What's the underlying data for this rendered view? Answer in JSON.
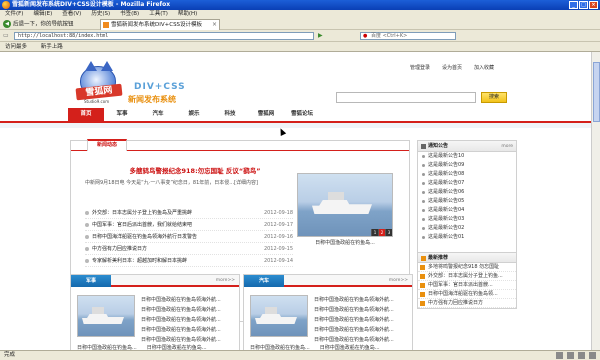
{
  "browser": {
    "title": "雪狐新闻发布系统DIV+CSS设计模板 - Mozilla Firefox",
    "menu": [
      "文件(F)",
      "编辑(E)",
      "查看(V)",
      "历史(S)",
      "书签(B)",
      "工具(T)",
      "帮助(H)"
    ],
    "nav_back": "后退一下，你的导航按钮",
    "tab_label": "雪狐新闻发布系统DIV+CSS设计模板",
    "tab_close": "×",
    "url": "http://localhost:88/index.html",
    "search_placeholder": "百度 <Ctrl+K>",
    "bookmarks": [
      "访问最多",
      "新手上路"
    ],
    "status": "完成"
  },
  "header": {
    "top_links": [
      "管理登录",
      "设为首页",
      "加入收藏"
    ],
    "logo_text": "雪狐网",
    "logo_sub": "Studio9.com",
    "div_css": "DIV+CSS",
    "slogan": "新闻发布系统",
    "search_button": "搜索"
  },
  "nav": {
    "items": [
      "首页",
      "军事",
      "汽车",
      "娱乐",
      "科技",
      "雪狐网",
      "雪狐论坛"
    ],
    "active_index": 0
  },
  "featured": {
    "tab": "新闻动态",
    "headline": "多艘鸫鸟警报纪念918:勿忘国耻 反议“鹞鸟”",
    "summary": "中新网9月18日电 今天是“九·一八事变”纪念日，81年前，日本侵...[详细内容]",
    "news": [
      {
        "title": "外交部：日本志属分子登上钓鱼岛及严重挑衅",
        "date": "2012-09-18"
      },
      {
        "title": "中国军事：官日后派出首艘，我们就给结束吧",
        "date": "2012-09-17"
      },
      {
        "title": "日称中国海洋船驱在钓鱼岛领海外航行日发警告",
        "date": "2012-09-16"
      },
      {
        "title": "中方强有力回应推说日方",
        "date": "2012-09-15"
      },
      {
        "title": "专家解析美利日本：超越加时和解日本挑衅",
        "date": "2012-09-14"
      }
    ],
    "photo_caption": "日称中国渔政船在钓鱼岛...",
    "photo_controls": [
      "1",
      "2",
      "3"
    ]
  },
  "sidebar": {
    "notice_title": "通知公告",
    "more": "more",
    "notices": [
      "这是最新公告10",
      "这是最新公告09",
      "这是最新公告08",
      "这是最新公告07",
      "这是最新公告06",
      "这是最新公告05",
      "这是最新公告04",
      "这是最新公告03",
      "这是最新公告02",
      "这是最新公告01"
    ],
    "hot_title": "最新推荐",
    "hot": [
      "多地将鸣警报纪念918 勿忘国耻",
      "外交部：日本志属分子登上钓鱼...",
      "中国军事：官日本派出首艘...",
      "日称中国海洋船驱在钓鱼岛领...",
      "中方强有力回应推说日方"
    ]
  },
  "modules": [
    {
      "tab": "军事",
      "more": "more>>",
      "lines": [
        "日称中国渔政船在钓鱼岛领海外航...",
        "日称中国渔政船在钓鱼岛领海外航...",
        "日称中国渔政船在钓鱼岛领海外航...",
        "日称中国渔政船在钓鱼岛领海外航...",
        "日称中国渔政船在钓鱼岛领海外航..."
      ],
      "foot": [
        "日称中国渔政船在钓鱼岛...",
        "日称中国渔政船在钓鱼岛..."
      ]
    },
    {
      "tab": "汽车",
      "more": "more>>",
      "lines": [
        "日称中国渔政船在钓鱼岛领海外航...",
        "日称中国渔政船在钓鱼岛领海外航...",
        "日称中国渔政船在钓鱼岛领海外航...",
        "日称中国渔政船在钓鱼岛领海外航...",
        "日称中国渔政船在钓鱼岛领海外航..."
      ],
      "foot": [
        "日称中国渔政船在钓鱼岛...",
        "日称中国渔政船在钓鱼岛..."
      ]
    }
  ],
  "colors": {
    "accent_red": "#d4201b",
    "module_tab_blue": "#1469ad",
    "search_yellow": "#f2c21b",
    "slogan_orange": "#e9900f",
    "titlebar_blue": "#0a3fb5"
  }
}
